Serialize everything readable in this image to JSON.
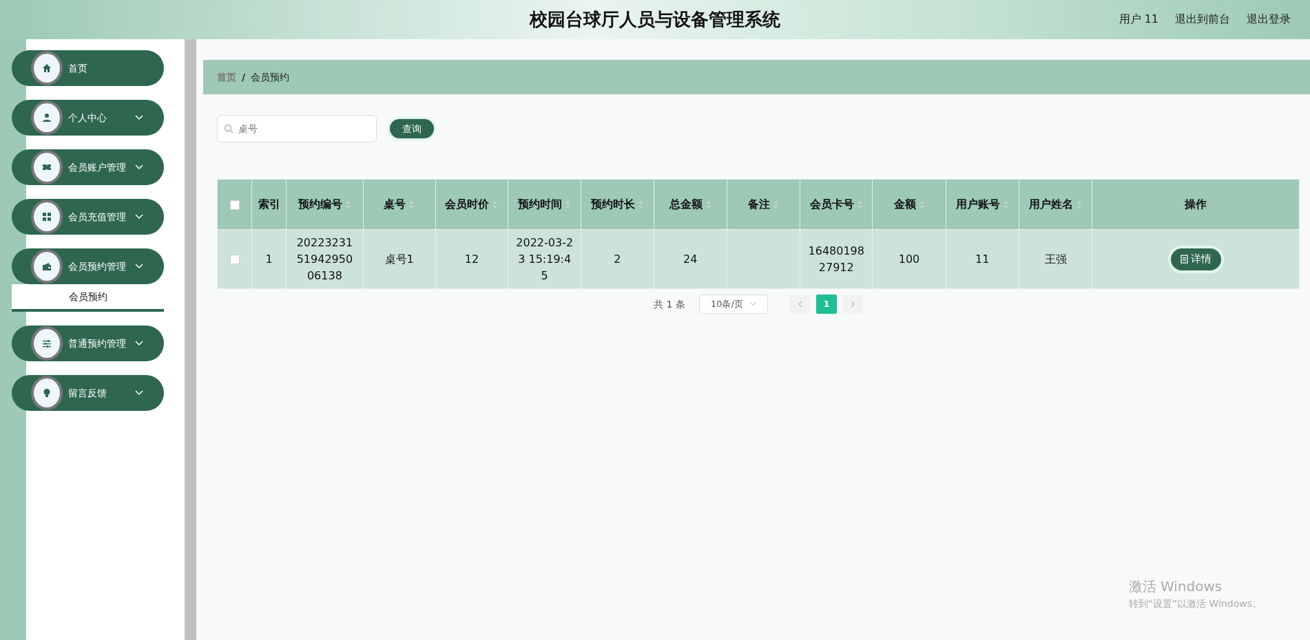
{
  "header": {
    "title": "校园台球厅人员与设备管理系统",
    "user": "用户 11",
    "links": [
      "退出到前台",
      "退出登录"
    ]
  },
  "sidebar": {
    "items": [
      {
        "label": "首页",
        "kind": "link"
      },
      {
        "label": "个人中心",
        "kind": "group"
      },
      {
        "label": "会员账户管理",
        "kind": "group"
      },
      {
        "label": "会员充值管理",
        "kind": "group"
      },
      {
        "label": "会员预约管理",
        "kind": "group",
        "children": [
          {
            "label": "会员预约",
            "selected": true
          }
        ]
      },
      {
        "label": "普通预约管理",
        "kind": "group"
      },
      {
        "label": "留言反馈",
        "kind": "group"
      }
    ]
  },
  "breadcrumb": {
    "items": [
      "首页",
      "会员预约"
    ],
    "separator": "/"
  },
  "search": {
    "placeholder": "桌号",
    "button": "查询"
  },
  "table": {
    "columns": [
      {
        "label": "索引",
        "sortable": false
      },
      {
        "label": "预约编号",
        "sortable": true
      },
      {
        "label": "桌号",
        "sortable": true
      },
      {
        "label": "会员时价",
        "sortable": true
      },
      {
        "label": "预约时间",
        "sortable": true
      },
      {
        "label": "预约时长",
        "sortable": true
      },
      {
        "label": "总金额",
        "sortable": true
      },
      {
        "label": "备注",
        "sortable": true
      },
      {
        "label": "会员卡号",
        "sortable": true
      },
      {
        "label": "金额",
        "sortable": true
      },
      {
        "label": "用户账号",
        "sortable": true
      },
      {
        "label": "用户姓名",
        "sortable": true
      },
      {
        "label": "操作",
        "sortable": false
      }
    ],
    "all_checked": false,
    "rows": [
      {
        "checked": false,
        "cells": [
          "1",
          "202232315194295006138",
          "桌号1",
          "12",
          "2022-03-23 15:19:45",
          "2",
          "24",
          "",
          "1648019827912",
          "100",
          "11",
          "王强"
        ],
        "action": "详情"
      }
    ]
  },
  "pagination": {
    "total": "共 1 条",
    "page_size": "10条/页",
    "pages": [
      {
        "label": "1",
        "selected": true
      }
    ]
  },
  "os_notice": [
    "激活 Windows",
    "转到“设置”以激活 Windows。"
  ]
}
